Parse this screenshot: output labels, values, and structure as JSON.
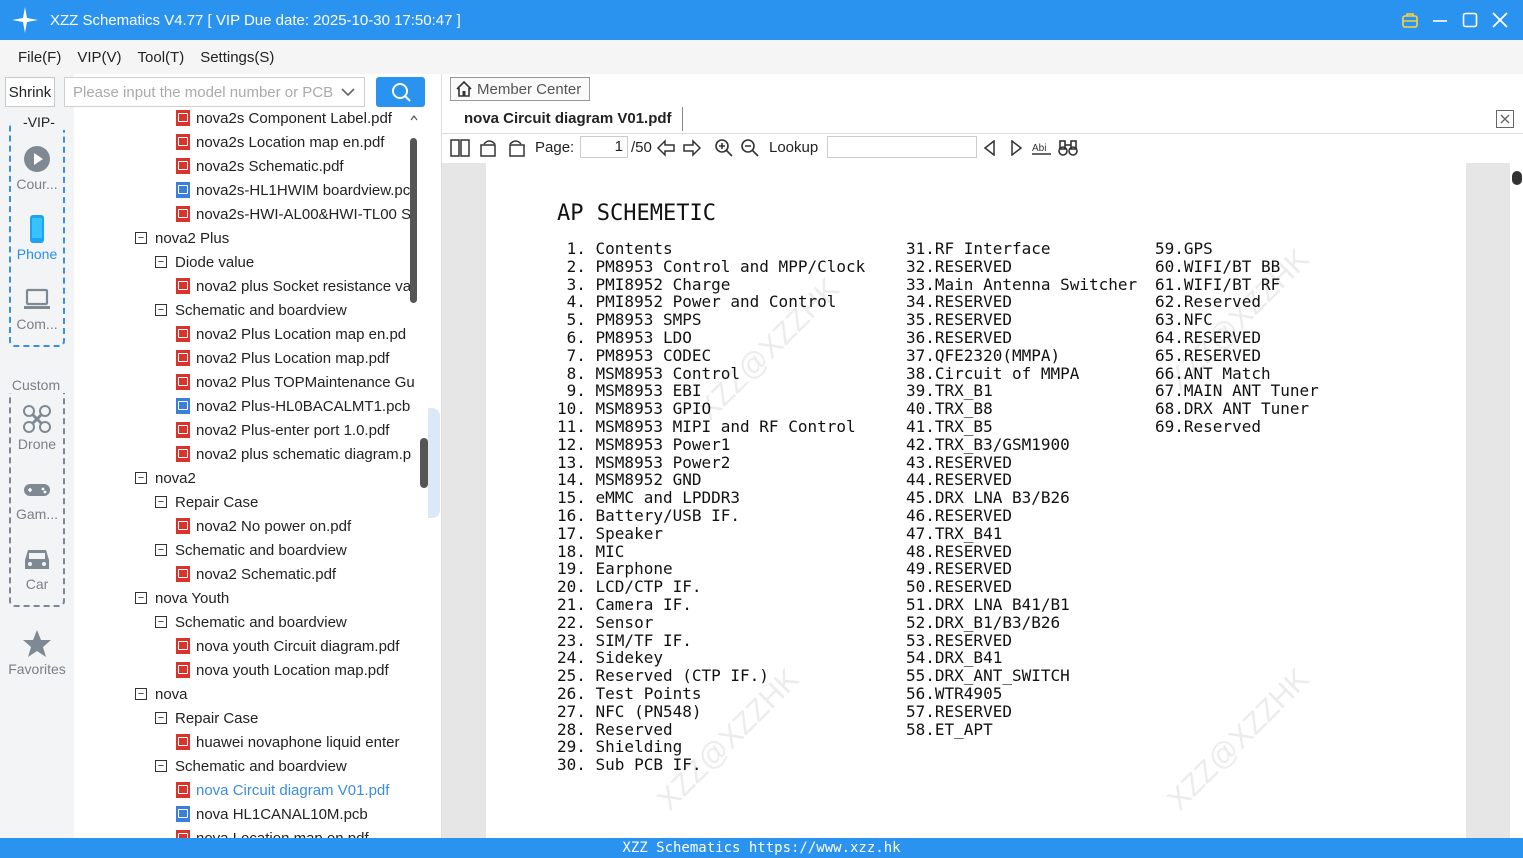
{
  "window": {
    "title": "XZZ Schematics V4.77 [ VIP Due date: 2025-10-30 17:50:47 ]"
  },
  "menu": [
    "File(F)",
    "VIP(V)",
    "Tool(T)",
    "Settings(S)"
  ],
  "left_nav": {
    "shrink_label": "Shrink",
    "vip_label": "VIP",
    "custom_label": "Custom",
    "items": [
      {
        "label": "Cour...",
        "icon": "play-icon"
      },
      {
        "label": "Phone",
        "icon": "phone-icon"
      },
      {
        "label": "Com...",
        "icon": "laptop-icon"
      },
      {
        "label": "Drone",
        "icon": "drone-icon"
      },
      {
        "label": "Gam...",
        "icon": "gamepad-icon"
      },
      {
        "label": "Car",
        "icon": "car-icon"
      },
      {
        "label": "Favorites",
        "icon": "star-icon"
      }
    ]
  },
  "search": {
    "placeholder": "Please input the model number or PCB"
  },
  "tree": [
    {
      "label": "nova2s Component Label.pdf",
      "type": "pdf",
      "level": 2
    },
    {
      "label": "nova2s Location map en.pdf",
      "type": "pdf",
      "level": 2
    },
    {
      "label": "nova2s Schematic.pdf",
      "type": "pdf",
      "level": 2
    },
    {
      "label": "nova2s-HL1HWIM boardview.pc",
      "type": "pcb",
      "level": 2
    },
    {
      "label": "nova2s-HWI-AL00&HWI-TL00 S",
      "type": "pdf",
      "level": 2
    },
    {
      "label": "nova2 Plus",
      "type": "folder",
      "level": 0
    },
    {
      "label": "Diode value",
      "type": "folder",
      "level": 1
    },
    {
      "label": "nova2 plus Socket resistance va",
      "type": "pdf",
      "level": 2
    },
    {
      "label": "Schematic and boardview",
      "type": "folder",
      "level": 1
    },
    {
      "label": "nova2 Plus Location map en.pd",
      "type": "pdf",
      "level": 2
    },
    {
      "label": "nova2 Plus Location map.pdf",
      "type": "pdf",
      "level": 2
    },
    {
      "label": "nova2 Plus TOPMaintenance Gu",
      "type": "pdf",
      "level": 2
    },
    {
      "label": "nova2 Plus-HL0BACALMT1.pcb",
      "type": "pcb",
      "level": 2
    },
    {
      "label": "nova2 Plus-enter port 1.0.pdf",
      "type": "pdf",
      "level": 2
    },
    {
      "label": "nova2 plus schematic diagram.p",
      "type": "pdf",
      "level": 2
    },
    {
      "label": "nova2",
      "type": "folder",
      "level": 0
    },
    {
      "label": "Repair Case",
      "type": "folder",
      "level": 1
    },
    {
      "label": "nova2 No power on.pdf",
      "type": "pdf",
      "level": 2
    },
    {
      "label": "Schematic and boardview",
      "type": "folder",
      "level": 1
    },
    {
      "label": "nova2 Schematic.pdf",
      "type": "pdf",
      "level": 2
    },
    {
      "label": "nova Youth",
      "type": "folder",
      "level": 0
    },
    {
      "label": "Schematic and boardview",
      "type": "folder",
      "level": 1
    },
    {
      "label": "nova youth Circuit diagram.pdf",
      "type": "pdf",
      "level": 2
    },
    {
      "label": "nova youth Location map.pdf",
      "type": "pdf",
      "level": 2
    },
    {
      "label": "nova",
      "type": "folder",
      "level": 0
    },
    {
      "label": "Repair Case",
      "type": "folder",
      "level": 1
    },
    {
      "label": "huawei novaphone liquid enter",
      "type": "pdf",
      "level": 2
    },
    {
      "label": "Schematic and boardview",
      "type": "folder",
      "level": 1
    },
    {
      "label": "nova Circuit diagram V01.pdf",
      "type": "pdf",
      "level": 2,
      "selected": true
    },
    {
      "label": "nova HL1CANAL10M.pcb",
      "type": "pcb",
      "level": 2
    },
    {
      "label": "nova Location map en.pdf",
      "type": "pdf",
      "level": 2
    }
  ],
  "viewer": {
    "member_center": "Member Center",
    "tab_name": "nova Circuit diagram V01.pdf",
    "page_label": "Page:",
    "page_current": "1",
    "page_total": "/50",
    "lookup_label": "Lookup"
  },
  "document": {
    "title": "AP SCHEMETIC",
    "watermark": "XZZ@XZZHK",
    "col1": [
      " 1. Contents",
      " 2. PM8953 Control and MPP/Clock",
      " 3. PMI8952 Charge",
      " 4. PMI8952 Power and Control",
      " 5. PM8953 SMPS",
      " 6. PM8953 LDO",
      " 7. PM8953 CODEC",
      " 8. MSM8953 Control",
      " 9. MSM8953 EBI",
      "10. MSM8953 GPIO",
      "11. MSM8953 MIPI and RF Control",
      "12. MSM8953 Power1",
      "13. MSM8953 Power2",
      "14. MSM8952 GND",
      "15. eMMC and LPDDR3",
      "16. Battery/USB IF.",
      "17. Speaker",
      "18. MIC",
      "19. Earphone",
      "20. LCD/CTP IF.",
      "21. Camera IF.",
      "22. Sensor",
      "23. SIM/TF IF.",
      "24. Sidekey",
      "25. Reserved (CTP IF.)",
      "26. Test Points",
      "27. NFC (PN548)",
      "28. Reserved",
      "29. Shielding",
      "30. Sub PCB IF."
    ],
    "col2": [
      "31.RF Interface",
      "32.RESERVED",
      "33.Main Antenna Switcher",
      "34.RESERVED",
      "35.RESERVED",
      "36.RESERVED",
      "37.QFE2320(MMPA)",
      "38.Circuit of MMPA",
      "39.TRX_B1",
      "40.TRX_B8",
      "41.TRX_B5",
      "42.TRX_B3/GSM1900",
      "43.RESERVED",
      "44.RESERVED",
      "45.DRX LNA B3/B26",
      "46.RESERVED",
      "47.TRX_B41",
      "48.RESERVED",
      "49.RESERVED",
      "50.RESERVED",
      "51.DRX LNA B41/B1",
      "52.DRX_B1/B3/B26",
      "53.RESERVED",
      "54.DRX_B41",
      "55.DRX_ANT_SWITCH",
      "56.WTR4905",
      "57.RESERVED",
      "58.ET_APT"
    ],
    "col3": [
      "59.GPS",
      "60.WIFI/BT BB",
      "61.WIFI/BT RF",
      "62.Reserved",
      "63.NFC",
      "64.RESERVED",
      "65.RESERVED",
      "66.ANT Match",
      "67.MAIN ANT Tuner",
      "68.DRX ANT Tuner",
      "69.Reserved"
    ]
  },
  "status_bar": "XZZ Schematics https://www.xzz.hk",
  "colors": {
    "accent": "#2a93f0",
    "pdf_icon": "#d9342b",
    "pcb_icon": "#3c7fd8",
    "selected_text": "#3a8de0"
  }
}
